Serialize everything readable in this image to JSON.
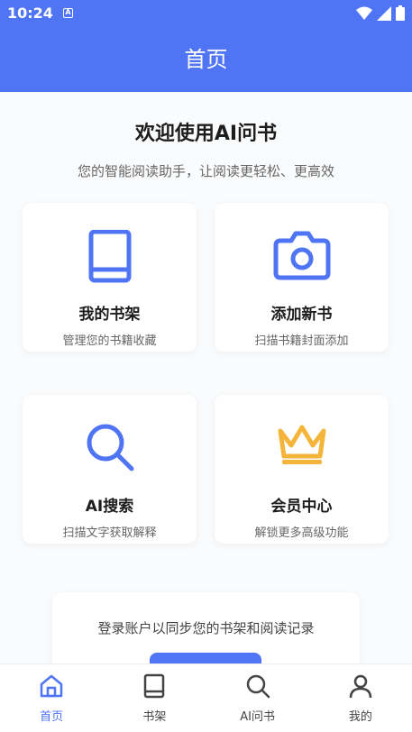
{
  "status_bar": {
    "time": "10:24",
    "notif_glyph": "A",
    "icons": [
      "wifi-icon",
      "signal-icon",
      "battery-icon"
    ]
  },
  "app_bar": {
    "title": "首页"
  },
  "welcome": {
    "title": "欢迎使用AI问书",
    "subtitle": "您的智能阅读助手，让阅读更轻松、更高效"
  },
  "cards": [
    {
      "title": "我的书架",
      "desc": "管理您的书籍收藏",
      "icon": "book-icon"
    },
    {
      "title": "添加新书",
      "desc": "扫描书籍封面添加",
      "icon": "camera-icon"
    },
    {
      "title": "AI搜索",
      "desc": "扫描文字获取解释",
      "icon": "search-icon"
    },
    {
      "title": "会员中心",
      "desc": "解锁更多高级功能",
      "icon": "crown-icon"
    }
  ],
  "login": {
    "text": "登录账户以同步您的书架和阅读记录"
  },
  "nav": [
    {
      "label": "首页",
      "icon": "home-icon",
      "active": true
    },
    {
      "label": "书架",
      "icon": "book-icon",
      "active": false
    },
    {
      "label": "AI问书",
      "icon": "search-icon",
      "active": false
    },
    {
      "label": "我的",
      "icon": "person-icon",
      "active": false
    }
  ],
  "colors": {
    "primary": "#4f74f4",
    "gold": "#f5b53a"
  }
}
